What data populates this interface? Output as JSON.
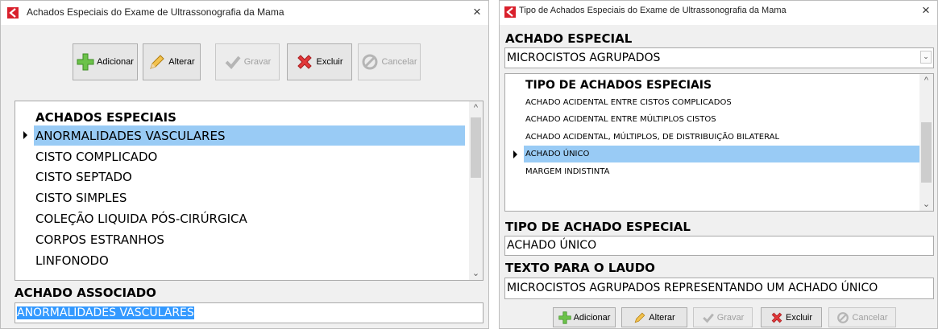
{
  "win1": {
    "title": "Achados Especiais do Exame de Ultrassonografia da Mama",
    "close": "×",
    "toolbar": {
      "add": "Adicionar",
      "edit": "Alterar",
      "save": "Gravar",
      "delete": "Excluir",
      "cancel": "Cancelar"
    },
    "list": {
      "header": "ACHADOS ESPECIAIS",
      "items": [
        "ANORMALIDADES VASCULARES",
        "CISTO COMPLICADO",
        "CISTO SEPTADO",
        "CISTO SIMPLES",
        "COLEÇÃO LIQUIDA PÓS-CIRÚRGICA",
        "CORPOS ESTRANHOS",
        "LINFONODO"
      ],
      "selected_index": 0
    },
    "assoc": {
      "label": "ACHADO ASSOCIADO",
      "value": "ANORMALIDADES VASCULARES"
    }
  },
  "win2": {
    "title": "Tipo de Achados Especiais do Exame de Ultrassonografia da Mama",
    "close": "×",
    "combo": {
      "label": "ACHADO ESPECIAL",
      "value": "MICROCISTOS AGRUPADOS"
    },
    "list": {
      "header": "TIPO DE ACHADOS ESPECIAIS",
      "items": [
        "ACHADO ACIDENTAL ENTRE CISTOS COMPLICADOS",
        "ACHADO ACIDENTAL ENTRE MÚLTIPLOS CISTOS",
        "ACHADO ACIDENTAL, MÚLTIPLOS, DE DISTRIBUIÇÃO BILATERAL",
        "ACHADO ÚNICO",
        "MARGEM INDISTINTA"
      ],
      "selected_index": 3
    },
    "tipo": {
      "label": "TIPO DE ACHADO ESPECIAL",
      "value": "ACHADO ÚNICO"
    },
    "texto": {
      "label": "TEXTO PARA O LAUDO",
      "value": "MICROCISTOS AGRUPADOS REPRESENTANDO UM ACHADO ÚNICO"
    },
    "toolbar": {
      "add": "Adicionar",
      "edit": "Alterar",
      "save": "Gravar",
      "delete": "Excluir",
      "cancel": "Cancelar"
    }
  },
  "colors": {
    "selection": "#99cbf5",
    "highlight": "#3399ff",
    "app_icon": "#d9202c"
  }
}
